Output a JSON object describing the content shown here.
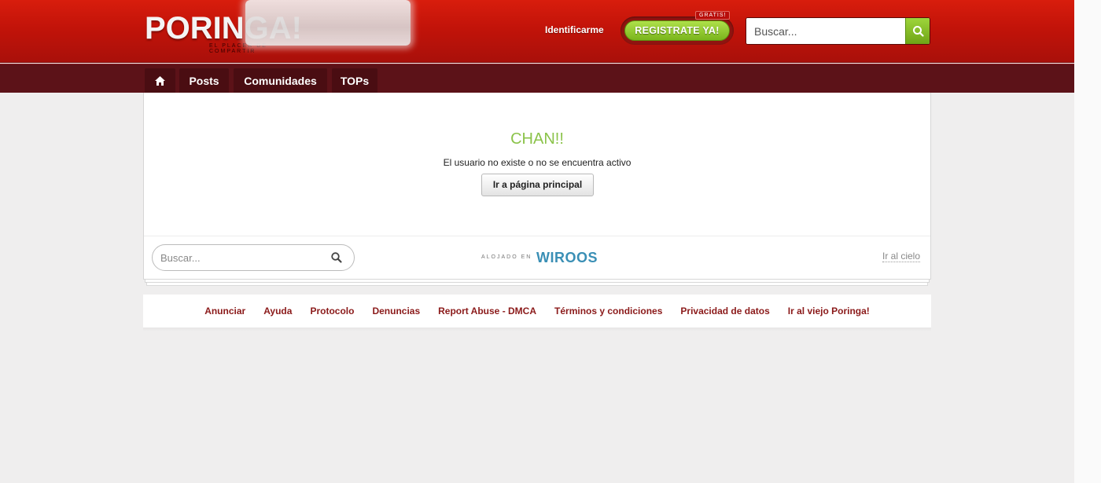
{
  "header": {
    "logo_text": "PORINGA!",
    "logo_tagline": "el placer de compartir",
    "login_label": "Identificarme",
    "register_label": "REGISTRATE YA!",
    "register_badge": "GRATIS!",
    "search_placeholder": "Buscar..."
  },
  "nav": {
    "items": [
      {
        "label": "",
        "icon": "home-icon"
      },
      {
        "label": "Posts"
      },
      {
        "label": "Comunidades"
      },
      {
        "label": "TOPs"
      }
    ]
  },
  "main": {
    "title": "CHAN!!",
    "message": "El usuario no existe o no se encuentra activo",
    "home_button": "Ir a página principal"
  },
  "card_footer": {
    "search_placeholder": "Buscar...",
    "hosted_label": "ALOJADO EN",
    "hosted_brand": "WIROOS",
    "to_top_label": "Ir al cielo"
  },
  "footer": {
    "links": [
      "Anunciar",
      "Ayuda",
      "Protocolo",
      "Denuncias",
      "Report Abuse - DMCA",
      "Términos y condiciones",
      "Privacidad de datos",
      "Ir al viejo Poringa!"
    ]
  },
  "colors": {
    "header_red": "#c21309",
    "nav_dark": "#5c1218",
    "accent_green": "#8bc34a",
    "footer_link": "#8b1a1a",
    "wiroos_blue": "#3a8fb5"
  }
}
